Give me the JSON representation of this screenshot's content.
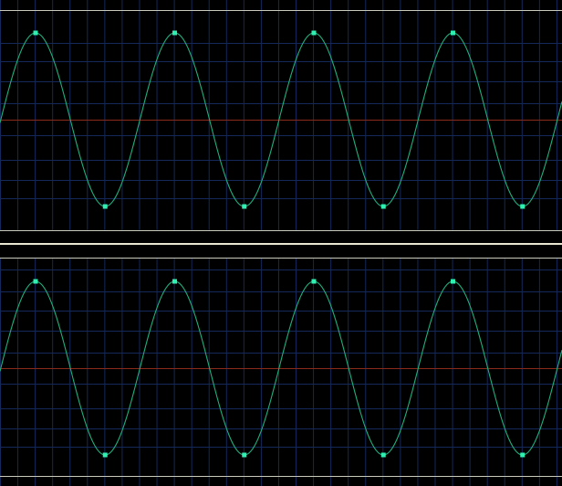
{
  "colors": {
    "background": "#000000",
    "grid": "#14285a",
    "grid_bright": "#3a4f8a",
    "waveform": "#1fae7e",
    "sample_point": "#2ff0b0",
    "center_line": "#8a2a1a",
    "channel_boundary": "#c9c9bc",
    "separator_bar": "#e9e7d2"
  },
  "waveform": {
    "shape": "sine",
    "cycles_visible": 3.99,
    "samples": [
      {
        "phase": 0.25,
        "value": 1
      },
      {
        "phase": 0.75,
        "value": -1
      },
      {
        "phase": 1.25,
        "value": 1
      },
      {
        "phase": 1.75,
        "value": -1
      },
      {
        "phase": 2.25,
        "value": 1
      },
      {
        "phase": 2.75,
        "value": -1
      },
      {
        "phase": 3.25,
        "value": 1
      },
      {
        "phase": 3.75,
        "value": -1
      }
    ]
  },
  "channels": [
    {
      "id": "channel-1"
    },
    {
      "id": "channel-2"
    }
  ]
}
